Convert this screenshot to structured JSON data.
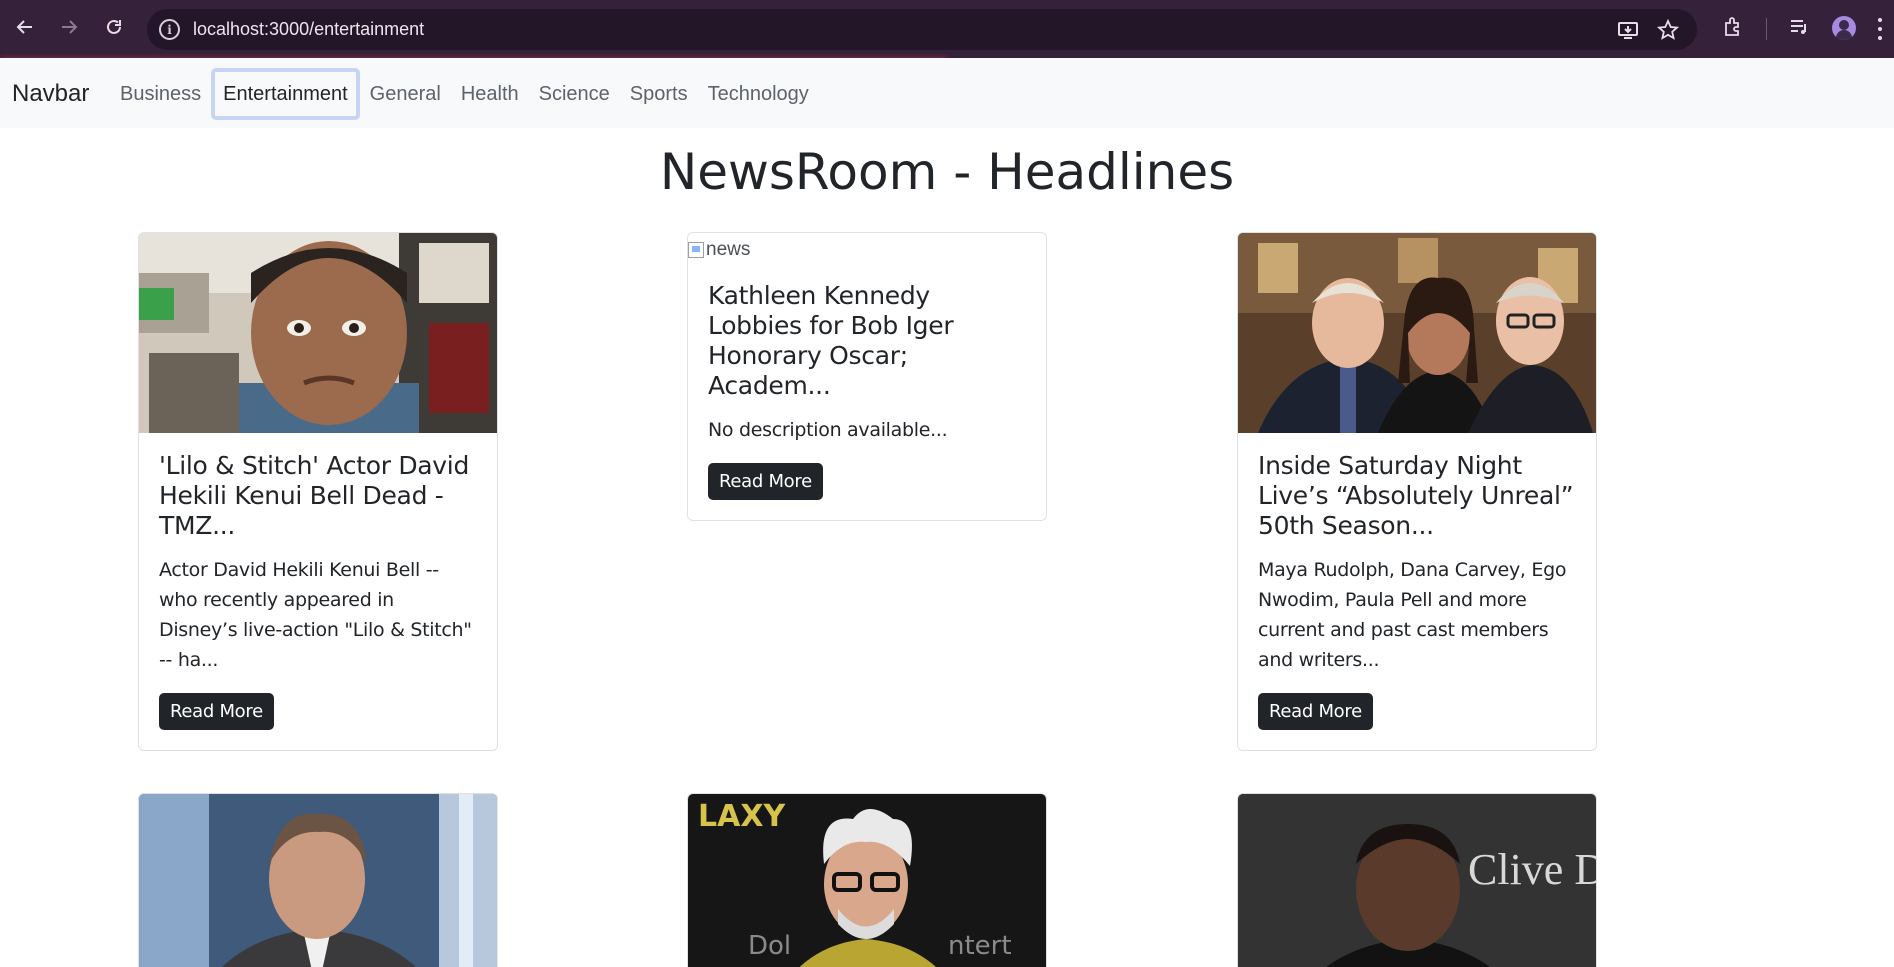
{
  "browser": {
    "url": "localhost:3000/entertainment"
  },
  "navbar": {
    "brand": "Navbar",
    "links": [
      {
        "label": "Business",
        "active": false
      },
      {
        "label": "Entertainment",
        "active": true
      },
      {
        "label": "General",
        "active": false
      },
      {
        "label": "Health",
        "active": false
      },
      {
        "label": "Science",
        "active": false
      },
      {
        "label": "Sports",
        "active": false
      },
      {
        "label": "Technology",
        "active": false
      }
    ]
  },
  "page": {
    "title": "NewsRoom - Headlines"
  },
  "cards": [
    {
      "image": "portrait-man-office",
      "title": "'Lilo & Stitch' Actor David Hekili Kenui Bell Dead - TMZ...",
      "description": "Actor David Hekili Kenui Bell -- who recently appeared in Disney’s live-action \"Lilo & Stitch\" -- ha...",
      "button": "Read More"
    },
    {
      "image_alt": "news",
      "title": "Kathleen Kennedy Lobbies for Bob Iger Honorary Oscar; Academ...",
      "description": "No description available...",
      "button": "Read More"
    },
    {
      "image": "three-people-hallway",
      "title": "Inside Saturday Night Live’s “Absolutely Unreal” 50th Season...",
      "description": "Maya Rudolph, Dana Carvey, Ego Nwodim, Paula Pell and more current and past cast members and writers...",
      "button": "Read More"
    }
  ],
  "second_row": [
    {
      "image": "man-in-suit"
    },
    {
      "image": "man-glasses-yellow-jacket"
    },
    {
      "image": "man-red-carpet",
      "image_text": "Clive D"
    }
  ]
}
